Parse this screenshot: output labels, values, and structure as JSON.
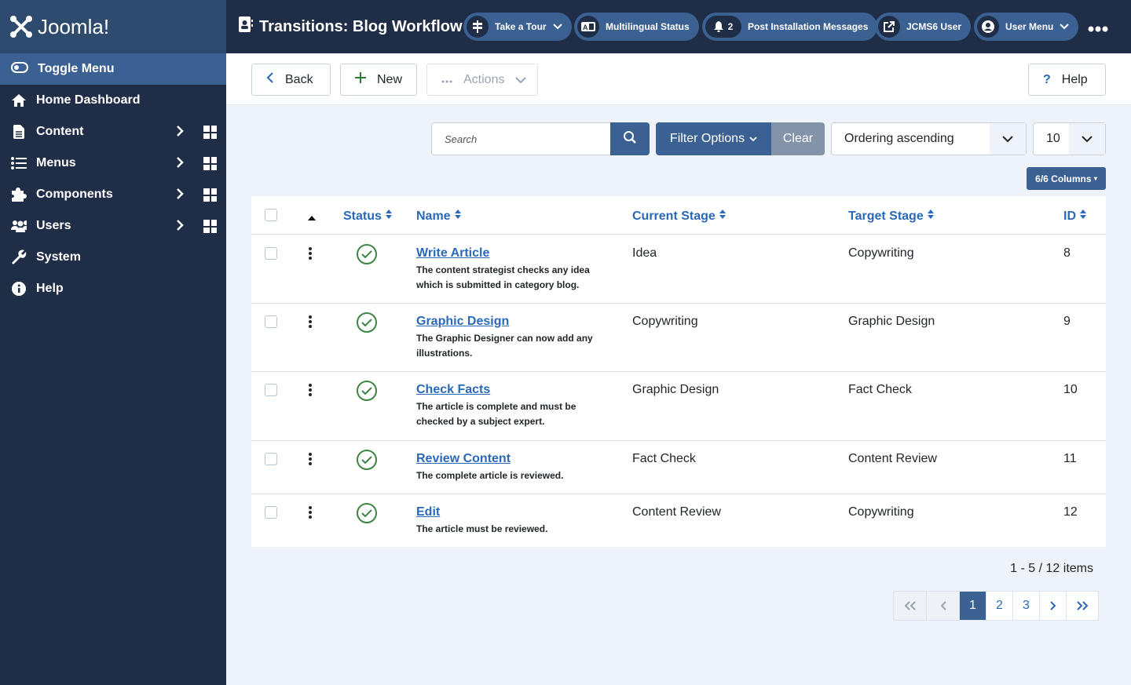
{
  "app": {
    "logo_text": "Joomla!",
    "page_title": "Transitions: Blog Workflow"
  },
  "sidebar": {
    "toggle_label": "Toggle Menu",
    "items": [
      {
        "label": "Home Dashboard",
        "icon": "home-icon"
      },
      {
        "label": "Content",
        "icon": "file-icon"
      },
      {
        "label": "Menus",
        "icon": "list-icon"
      },
      {
        "label": "Components",
        "icon": "puzzle-icon"
      },
      {
        "label": "Users",
        "icon": "users-icon"
      },
      {
        "label": "System",
        "icon": "wrench-icon"
      },
      {
        "label": "Help",
        "icon": "info-icon"
      }
    ]
  },
  "header": {
    "take_tour": "Take a Tour",
    "multilingual": "Multilingual Status",
    "post_install_count": "2",
    "post_install": "Post Installation Messages",
    "site_link": "JCMS6 User",
    "user_menu": "User Menu"
  },
  "toolbar": {
    "back": "Back",
    "new": "New",
    "actions": "Actions",
    "help": "Help"
  },
  "filters": {
    "search_placeholder": "Search",
    "filter_options": "Filter Options",
    "clear": "Clear",
    "ordering": "Ordering ascending",
    "limit": "10",
    "columns": "6/6 Columns"
  },
  "table": {
    "headers": {
      "status": "Status",
      "name": "Name",
      "current_stage": "Current Stage",
      "target_stage": "Target Stage",
      "id": "ID"
    },
    "rows": [
      {
        "name": "Write Article",
        "desc": "The content strategist checks any idea which is submitted in category blog.",
        "current": "Idea",
        "target": "Copywriting",
        "id": "8"
      },
      {
        "name": "Graphic Design",
        "desc": "The Graphic Designer can now add any illustrations.",
        "current": "Copywriting",
        "target": "Graphic Design",
        "id": "9"
      },
      {
        "name": "Check Facts",
        "desc": "The article is complete and must be checked by a subject expert.",
        "current": "Graphic Design",
        "target": "Fact Check",
        "id": "10"
      },
      {
        "name": "Review Content",
        "desc": "The complete article is reviewed.",
        "current": "Fact Check",
        "target": "Content Review",
        "id": "11"
      },
      {
        "name": "Edit",
        "desc": "The article must be reviewed.",
        "current": "Content Review",
        "target": "Copywriting",
        "id": "12"
      }
    ]
  },
  "pagination": {
    "summary": "1 - 5 / 12 items",
    "pages": [
      "1",
      "2",
      "3"
    ],
    "current": "1"
  }
}
